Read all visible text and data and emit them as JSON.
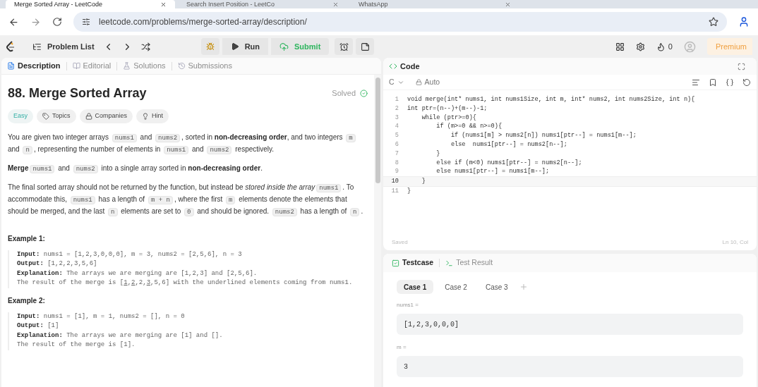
{
  "browser": {
    "tabs": [
      {
        "title": "Merge Sorted Array - LeetCode",
        "selected": true
      },
      {
        "title": "Search Insert Position - LeetCo",
        "selected": false
      },
      {
        "title": "WhatsApp",
        "selected": false
      }
    ],
    "url": "leetcode.com/problems/merge-sorted-array/description/"
  },
  "toolbar": {
    "problem_list": "Problem List",
    "run": "Run",
    "submit": "Submit",
    "streak": "0",
    "premium": "Premium"
  },
  "left_tabs": [
    {
      "label": "Description",
      "selected": true
    },
    {
      "label": "Editorial",
      "selected": false
    },
    {
      "label": "Solutions",
      "selected": false
    },
    {
      "label": "Submissions",
      "selected": false
    }
  ],
  "problem": {
    "title": "88. Merge Sorted Array",
    "status": "Solved",
    "difficulty": "Easy",
    "tags": [
      "Topics",
      "Companies",
      "Hint"
    ],
    "paragraphs": [
      [
        {
          "kind": "text",
          "text": "You are given two integer arrays "
        },
        {
          "kind": "code",
          "text": "nums1"
        },
        {
          "kind": "text",
          "text": " and "
        },
        {
          "kind": "code",
          "text": "nums2"
        },
        {
          "kind": "text",
          "text": ", sorted in "
        },
        {
          "kind": "bold",
          "text": "non-decreasing order"
        },
        {
          "kind": "text",
          "text": ", and two integers "
        },
        {
          "kind": "code",
          "text": "m"
        },
        {
          "kind": "text",
          "text": " and "
        },
        {
          "kind": "code",
          "text": "n"
        },
        {
          "kind": "text",
          "text": ", representing the number of elements in "
        },
        {
          "kind": "code",
          "text": "nums1"
        },
        {
          "kind": "text",
          "text": " and "
        },
        {
          "kind": "code",
          "text": "nums2"
        },
        {
          "kind": "text",
          "text": " respectively."
        }
      ],
      [
        {
          "kind": "bold",
          "text": "Merge"
        },
        {
          "kind": "code",
          "text": "nums1"
        },
        {
          "kind": "text",
          "text": " and "
        },
        {
          "kind": "code",
          "text": "nums2"
        },
        {
          "kind": "text",
          "text": " into a single array sorted in "
        },
        {
          "kind": "bold",
          "text": "non-decreasing order"
        },
        {
          "kind": "text",
          "text": "."
        }
      ],
      [
        {
          "kind": "text",
          "text": "The final sorted array should not be returned by the function, but instead be "
        },
        {
          "kind": "italic",
          "text": "stored inside the array"
        },
        {
          "kind": "code",
          "text": "nums1"
        },
        {
          "kind": "text",
          "text": ". To accommodate this, "
        },
        {
          "kind": "code",
          "text": "nums1"
        },
        {
          "kind": "text",
          "text": " has a length of "
        },
        {
          "kind": "code",
          "text": "m + n"
        },
        {
          "kind": "text",
          "text": ", where the first "
        },
        {
          "kind": "code",
          "text": "m"
        },
        {
          "kind": "text",
          "text": " elements denote the elements that should be merged, and the last "
        },
        {
          "kind": "code",
          "text": "n"
        },
        {
          "kind": "text",
          "text": " elements are set to "
        },
        {
          "kind": "code",
          "text": "0"
        },
        {
          "kind": "text",
          "text": " and should be ignored. "
        },
        {
          "kind": "code",
          "text": "nums2"
        },
        {
          "kind": "text",
          "text": " has a length of "
        },
        {
          "kind": "code",
          "text": "n"
        },
        {
          "kind": "text",
          "text": "."
        }
      ]
    ],
    "examples": [
      {
        "heading": "Example 1:",
        "lines": [
          {
            "label": "Input:",
            "parts": [
              {
                "text": "nums1 = [1,2,3,0,0,0], m = 3, nums2 = [2,5,6], n = 3",
                "underline": false
              }
            ]
          },
          {
            "label": "Output:",
            "parts": [
              {
                "text": "[1,2,2,3,5,6]",
                "underline": false
              }
            ]
          },
          {
            "label": "Explanation:",
            "parts": [
              {
                "text": "The arrays we are merging are [1,2,3] and [2,5,6].",
                "underline": false
              }
            ]
          },
          {
            "parts": [
              {
                "text": "The result of the merge is [",
                "underline": false
              },
              {
                "text": "1",
                "underline": true
              },
              {
                "text": ",",
                "underline": false
              },
              {
                "text": "2",
                "underline": true
              },
              {
                "text": ",2,",
                "underline": false
              },
              {
                "text": "3",
                "underline": true
              },
              {
                "text": ",5,6] with the underlined elements coming from nums1.",
                "underline": false
              }
            ]
          }
        ]
      },
      {
        "heading": "Example 2:",
        "lines": [
          {
            "label": "Input:",
            "parts": [
              {
                "text": "nums1 = [1], m = 1, nums2 = [], n = 0",
                "underline": false
              }
            ]
          },
          {
            "label": "Output:",
            "parts": [
              {
                "text": "[1]",
                "underline": false
              }
            ]
          },
          {
            "label": "Explanation:",
            "parts": [
              {
                "text": "The arrays we are merging are [1] and [].",
                "underline": false
              }
            ]
          },
          {
            "parts": [
              {
                "text": "The result of the merge is [1].",
                "underline": false
              }
            ]
          }
        ]
      }
    ]
  },
  "editor": {
    "title": "Code",
    "language": "C",
    "mode": "Auto",
    "status": "Saved",
    "cursor": "Ln 10, Col",
    "lines": [
      {
        "number": "1",
        "text": "void merge(int* nums1, int nums1Size, int m, int* nums2, int nums2Size, int n){",
        "current": false
      },
      {
        "number": "2",
        "text": "int ptr=(n--)+(m--)-1;",
        "current": false
      },
      {
        "number": "3",
        "text": "    while (ptr>=0){",
        "current": false
      },
      {
        "number": "4",
        "text": "        if (m>=0 && n>=0){",
        "current": false
      },
      {
        "number": "5",
        "text": "            if (nums1[m] > nums2[n]) nums1[ptr--] = nums1[m--];",
        "current": false
      },
      {
        "number": "6",
        "text": "            else  nums1[ptr--] = nums2[n--];",
        "current": false
      },
      {
        "number": "7",
        "text": "        }",
        "current": false
      },
      {
        "number": "8",
        "text": "        else if (m<0) nums1[ptr--] = nums2[n--];",
        "current": false
      },
      {
        "number": "9",
        "text": "        else nums1[ptr--] = nums1[m--];",
        "current": false
      },
      {
        "number": "10",
        "text": "    }",
        "current": true
      },
      {
        "number": "11",
        "text": "}",
        "current": false
      }
    ]
  },
  "testcase": {
    "tabs": [
      {
        "label": "Testcase",
        "selected": true
      },
      {
        "label": "Test Result",
        "selected": false
      }
    ],
    "cases": [
      {
        "label": "Case 1",
        "selected": true
      },
      {
        "label": "Case 2",
        "selected": false
      },
      {
        "label": "Case 3",
        "selected": false
      }
    ],
    "params": [
      {
        "name": "nums1 =",
        "value": "[1,2,3,0,0,0]"
      },
      {
        "name": "m =",
        "value": "3"
      }
    ]
  }
}
